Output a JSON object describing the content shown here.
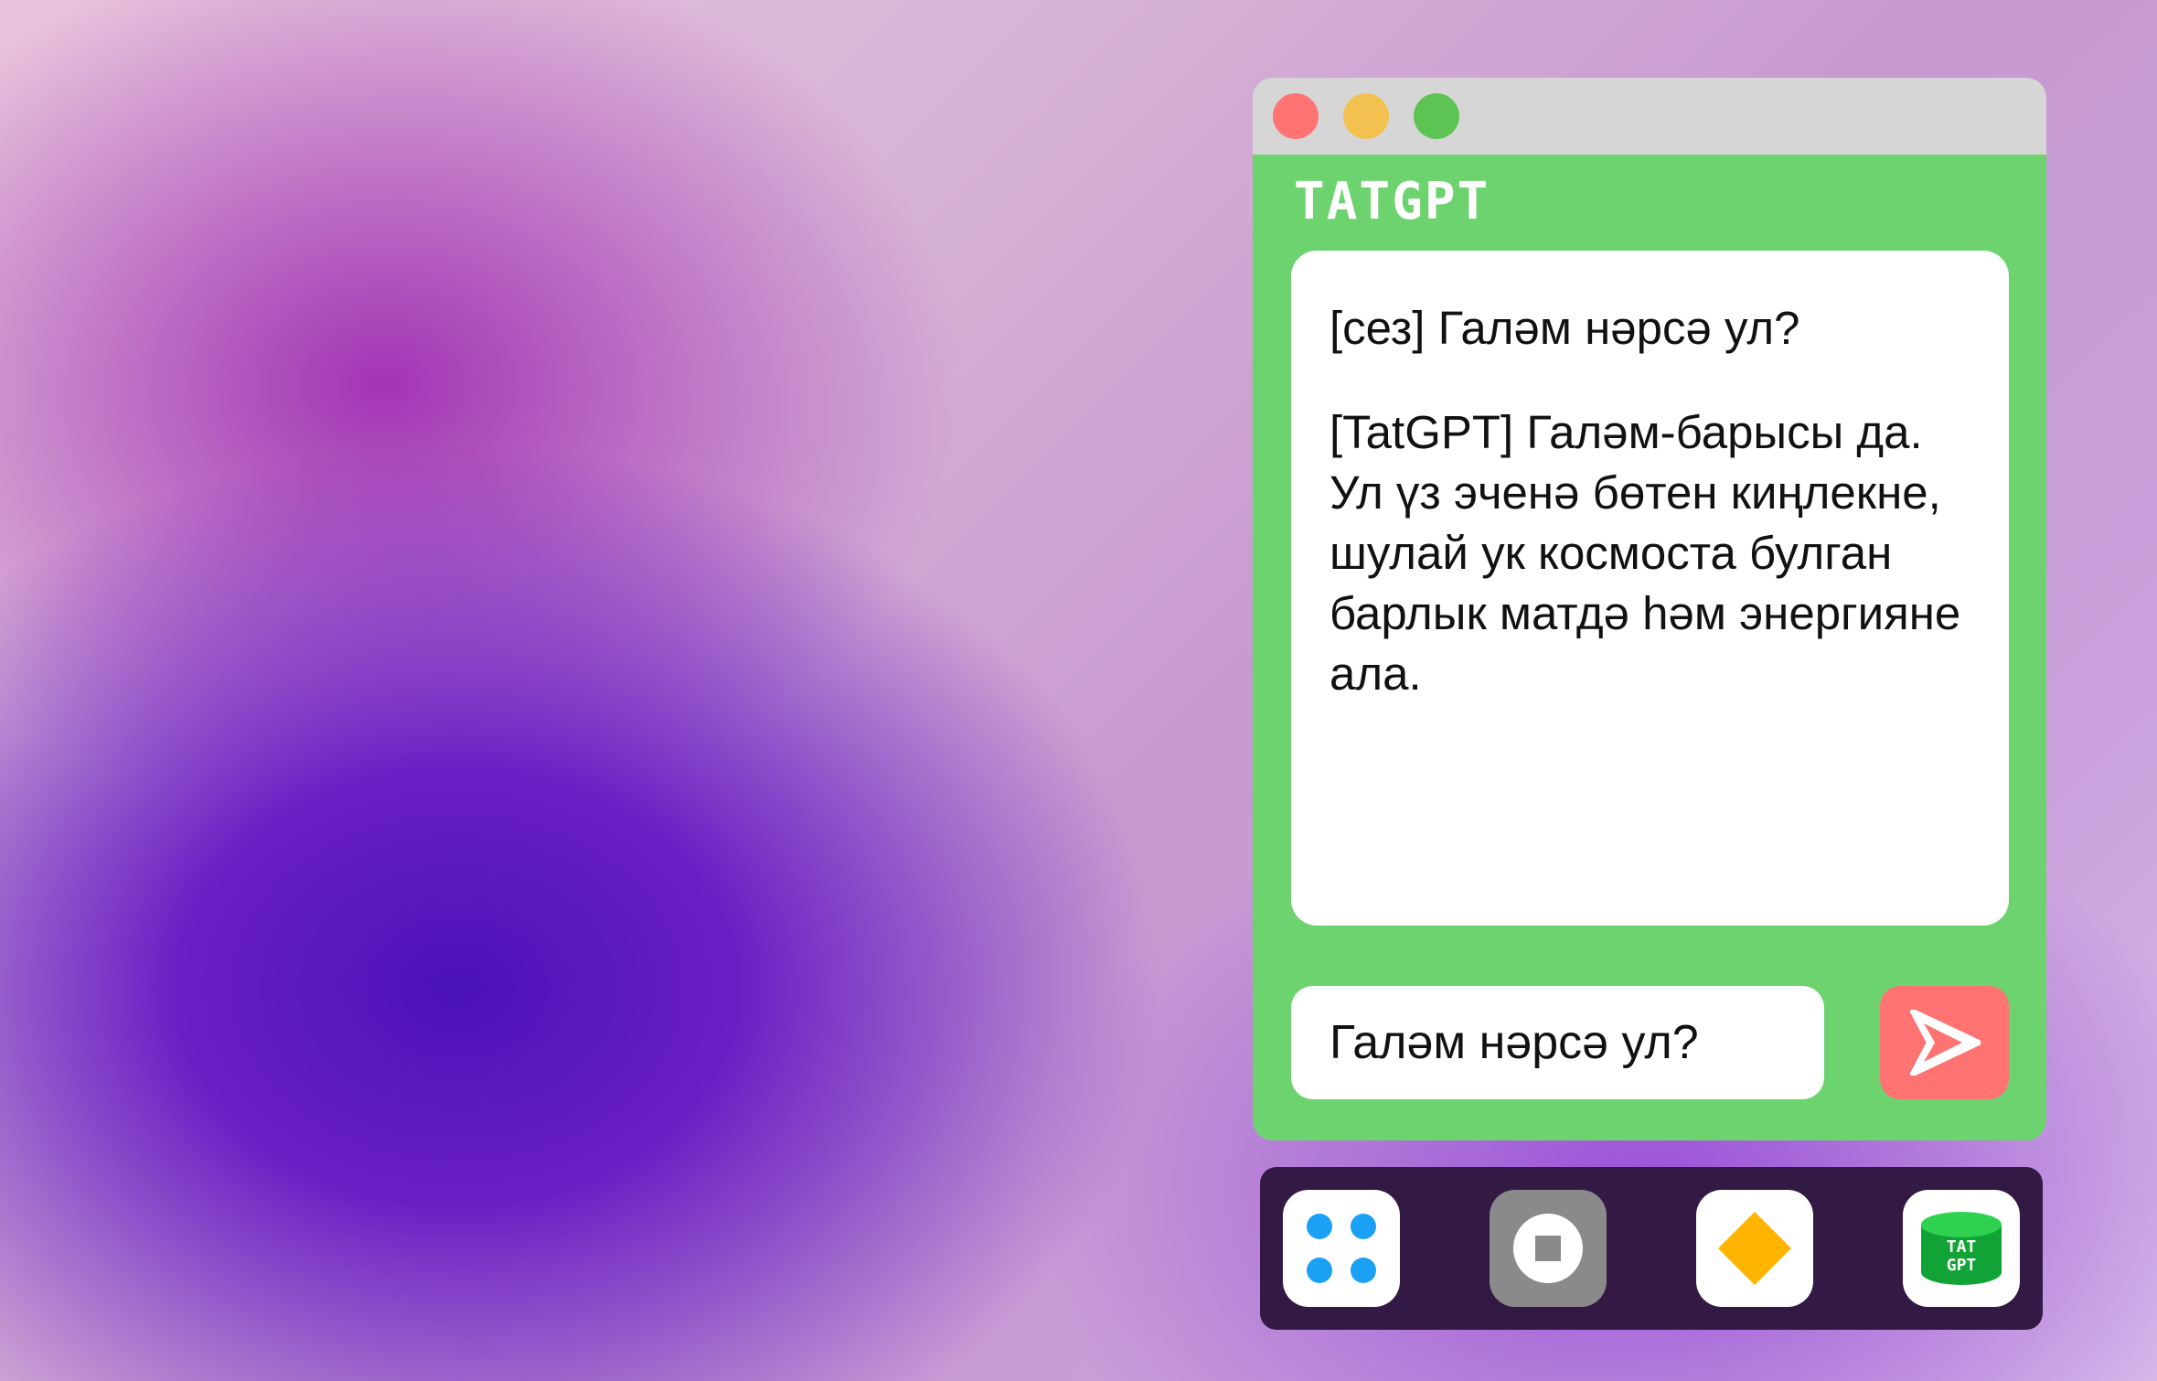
{
  "window": {
    "app_title": "TATGPT",
    "traffic_lights": {
      "close_color": "#ff7373",
      "minimize_color": "#f3c14f",
      "maximize_color": "#5dc454"
    },
    "accent_color": "#6dd36f"
  },
  "chat": {
    "messages": [
      {
        "role": "user",
        "text": "[сез] Галәм нәрсә ул?"
      },
      {
        "role": "assistant",
        "text": "[TatGPT] Галәм-барысы да. Ул үз эченә бөтен киңлекне, шулай ук космоста булган барлык матдә һәм энергияне ала."
      }
    ]
  },
  "input": {
    "value": "Галәм нәрсә ул?"
  },
  "send_button": {
    "icon": "send-arrow-icon",
    "color": "#ff7373"
  },
  "dock": {
    "items": [
      {
        "name": "apps-grid",
        "icon": "four-dots-grid-icon"
      },
      {
        "name": "stop",
        "icon": "stop-circle-icon"
      },
      {
        "name": "diamond-app",
        "icon": "yellow-diamond-icon"
      },
      {
        "name": "tatgpt-app",
        "icon": "tatgpt-cylinder-icon",
        "label": "TAT GPT",
        "label_line1": "TAT",
        "label_line2": "GPT"
      }
    ]
  }
}
